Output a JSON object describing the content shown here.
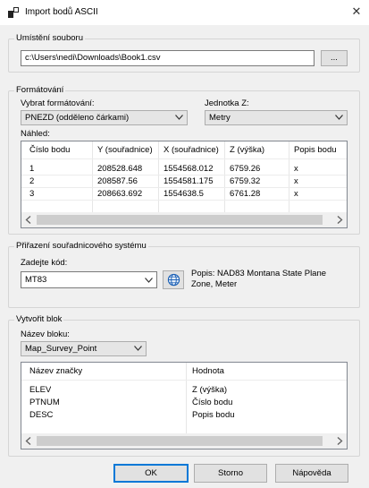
{
  "window": {
    "title": "Import bodů ASCII",
    "close_glyph": "✕"
  },
  "umisteni": {
    "title": "Umístění souboru",
    "path": "c:\\Users\\nedi\\Downloads\\Book1.csv",
    "browse_label": "..."
  },
  "formatovani": {
    "title": "Formátování",
    "format_label": "Vybrat formátování:",
    "format_value": "PNEZD (odděleno čárkami)",
    "unit_label": "Jednotka Z:",
    "unit_value": "Metry",
    "preview_label": "Náhled:",
    "columns": [
      "Číslo bodu",
      "Y (souřadnice)",
      "X (souřadnice)",
      "Z (výška)",
      "Popis bodu"
    ],
    "rows": [
      [
        "1",
        "208528.648",
        "1554568.012",
        "6759.26",
        "x"
      ],
      [
        "2",
        "208587.56",
        "1554581.175",
        "6759.32",
        "x"
      ],
      [
        "3",
        "208663.692",
        "1554638.5",
        "6761.28",
        "x"
      ]
    ]
  },
  "system": {
    "title": "Přiřazení souřadnicového systému",
    "code_label": "Zadejte kód:",
    "code_value": "MT83",
    "description_line1": "Popis: NAD83 Montana State Plane",
    "description_line2": "Zone, Meter"
  },
  "blok": {
    "title": "Vytvořit blok",
    "name_label": "Název bloku:",
    "name_value": "Map_Survey_Point",
    "columns": [
      "Název značky",
      "Hodnota"
    ],
    "rows": [
      [
        "ELEV",
        "Z (výška)"
      ],
      [
        "PTNUM",
        "Číslo bodu"
      ],
      [
        "DESC",
        "Popis bodu"
      ]
    ]
  },
  "buttons": {
    "ok": "OK",
    "cancel": "Storno",
    "help": "Nápověda"
  },
  "colors": {
    "accent": "#0078d7",
    "globe": "#1a5fb4"
  }
}
